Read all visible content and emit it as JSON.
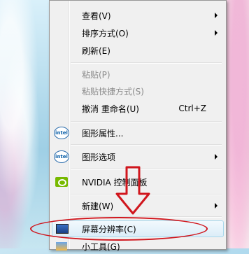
{
  "menu": {
    "items": [
      {
        "label": "查看(V)",
        "submenu": true
      },
      {
        "label": "排序方式(O)",
        "submenu": true
      },
      {
        "label": "刷新(E)"
      },
      {
        "label": "粘贴(P)",
        "disabled": true
      },
      {
        "label": "粘贴快捷方式(S)",
        "disabled": true
      },
      {
        "label": "撤消 重命名(U)",
        "shortcut": "Ctrl+Z"
      },
      {
        "label": "图形属性...",
        "icon": "intel-icon"
      },
      {
        "label": "图形选项",
        "icon": "intel-icon",
        "submenu": true
      },
      {
        "label": "NVIDIA 控制面板",
        "icon": "nvidia-icon"
      },
      {
        "label": "新建(W)",
        "submenu": true
      },
      {
        "label": "屏幕分辨率(C)",
        "icon": "monitor-icon",
        "highlighted": true
      },
      {
        "label": "小工具(G)",
        "icon": "gadgets-icon"
      }
    ],
    "intel_icon_text": "intel"
  },
  "annotation": {
    "color": "#d0161d"
  }
}
